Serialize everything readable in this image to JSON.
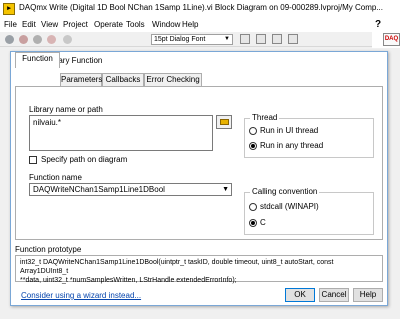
{
  "window": {
    "title": "DAQmx Write (Digital 1D Bool NChan 1Samp 1Line).vi Block Diagram on 09-000289.lvproj/My Comp..."
  },
  "menu": [
    "File",
    "Edit",
    "View",
    "Project",
    "Operate",
    "Tools",
    "Window",
    "Help"
  ],
  "toolbar": {
    "font_label": "15pt Dialog Font"
  },
  "dialog": {
    "title": "Call Library Function",
    "tabs": [
      "Function",
      "Parameters",
      "Callbacks",
      "Error Checking"
    ],
    "library": {
      "label": "Library name or path",
      "value": "nilvaiu.*"
    },
    "specify_path": {
      "label": "Specify path on diagram",
      "checked": false
    },
    "function_name": {
      "label": "Function name",
      "value": "DAQWriteNChan1Samp1Line1DBool"
    },
    "thread": {
      "title": "Thread",
      "options": [
        "Run in UI thread",
        "Run in any thread"
      ],
      "selected": "Run in any thread"
    },
    "calling_convention": {
      "title": "Calling convention",
      "options": [
        "stdcall (WINAPI)",
        "C"
      ],
      "selected": "C"
    },
    "prototype": {
      "label": "Function prototype",
      "line1": "int32_t DAQWriteNChan1Samp1Line1DBool(uintptr_t taskID, double timeout, uint8_t autoStart, const Array1DUInt8_t",
      "line2": "**data, uint32_t *numSamplesWritten, LStrHandle extendedErrorInfo);"
    },
    "wizard_link": "Consider using a wizard instead...",
    "buttons": {
      "ok": "OK",
      "cancel": "Cancel",
      "help": "Help"
    }
  }
}
